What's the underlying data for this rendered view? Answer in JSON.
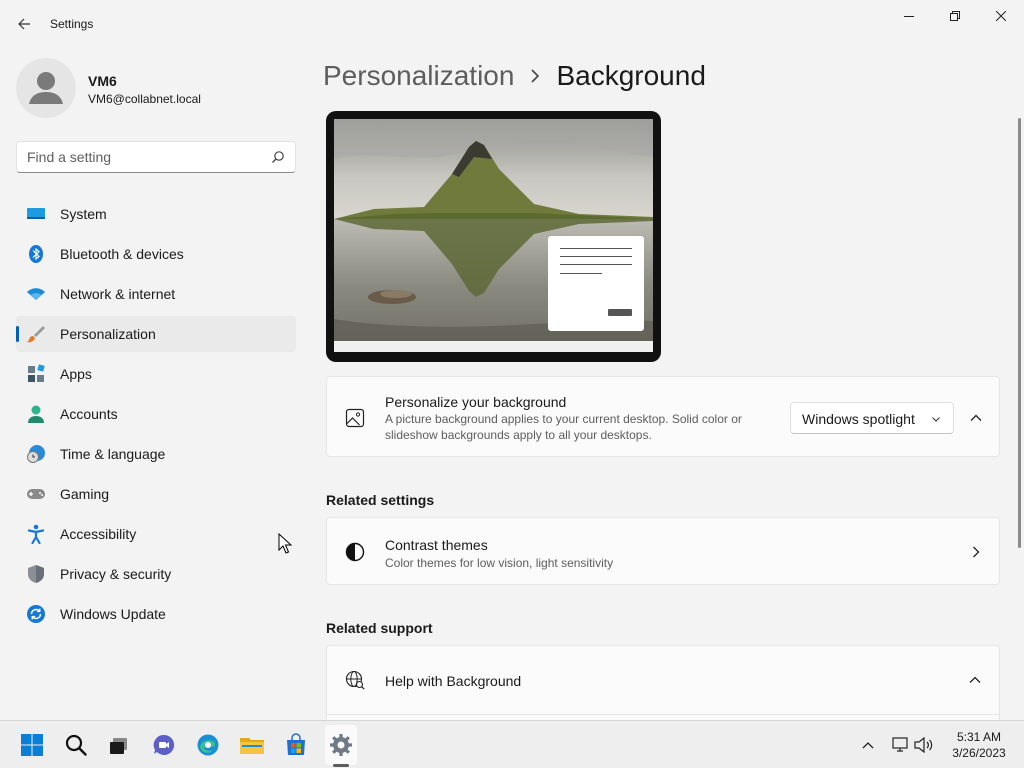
{
  "window": {
    "title": "Settings"
  },
  "user": {
    "name": "VM6",
    "email": "VM6@collabnet.local"
  },
  "search": {
    "placeholder": "Find a setting"
  },
  "sidebar": {
    "items": [
      {
        "label": "System",
        "icon": "system-icon"
      },
      {
        "label": "Bluetooth & devices",
        "icon": "bluetooth-icon"
      },
      {
        "label": "Network & internet",
        "icon": "wifi-icon"
      },
      {
        "label": "Personalization",
        "icon": "brush-icon",
        "active": true
      },
      {
        "label": "Apps",
        "icon": "apps-icon"
      },
      {
        "label": "Accounts",
        "icon": "accounts-icon"
      },
      {
        "label": "Time & language",
        "icon": "time-language-icon"
      },
      {
        "label": "Gaming",
        "icon": "gamepad-icon"
      },
      {
        "label": "Accessibility",
        "icon": "accessibility-icon"
      },
      {
        "label": "Privacy & security",
        "icon": "shield-icon"
      },
      {
        "label": "Windows Update",
        "icon": "update-icon"
      }
    ]
  },
  "breadcrumb": {
    "parent": "Personalization",
    "current": "Background"
  },
  "background_card": {
    "title": "Personalize your background",
    "description": "A picture background applies to your current desktop. Solid color or slideshow backgrounds apply to all your desktops.",
    "selected": "Windows spotlight"
  },
  "related_settings": {
    "heading": "Related settings",
    "items": [
      {
        "title": "Contrast themes",
        "description": "Color themes for low vision, light sensitivity"
      }
    ]
  },
  "related_support": {
    "heading": "Related support",
    "items": [
      {
        "title": "Help with Background"
      }
    ]
  },
  "taskbar": {
    "time": "5:31 AM",
    "date": "3/26/2023"
  },
  "colors": {
    "accent": "#005fb8",
    "background": "#f3f3f3",
    "card": "#fbfbfb"
  }
}
